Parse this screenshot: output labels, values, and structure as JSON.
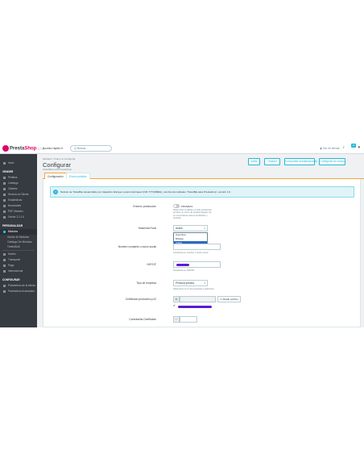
{
  "topbar": {
    "logo_text": "Presta",
    "logo_accent": "Shop",
    "version": "1.7.x",
    "quick_access": "Acceso rápido ▾",
    "search_placeholder": "Q  Buscar",
    "view_shop": "Ver mi tienda",
    "notifications_count": "11",
    "icons": [
      "eye-icon",
      "bell-icon",
      "user-icon"
    ]
  },
  "sidebar": {
    "top_items": [
      "Inicio"
    ],
    "sections": [
      {
        "title": "VENDER",
        "items": [
          "Pedidos",
          "Catálogo",
          "Clientes",
          "Servicio al Cliente",
          "Estadísticas",
          "Novedades",
          "PDF Maestro",
          "Gestor 2.1.1.0"
        ]
      },
      {
        "title": "PERSONALIZAR",
        "items": [
          "Módulos"
        ],
        "subitems": [
          "Gestor de Módulos",
          "Catálogo De Módulos",
          "TreebitSoft"
        ]
      },
      {
        "title": "",
        "items": [
          "Diseño",
          "Transporte",
          "Pago",
          "Internacional"
        ]
      },
      {
        "title": "CONFIGURAR",
        "items": [
          "Parámetros de la tienda",
          "Parámetros Avanzados"
        ]
      }
    ],
    "active_item": "Módulos",
    "colors": {
      "bg": "#363a41",
      "active_accent": "#25b9d7"
    }
  },
  "header": {
    "breadcrumb": "Módulos  /  Ticket  /  ▸ Configurar",
    "title": "Configurar",
    "subtitle": "TicketBAI para PrestaShop",
    "buttons": [
      "Atrás",
      "Traducir",
      "Comprobar actualizaciones",
      "Configurar los hooks"
    ]
  },
  "tabs": [
    {
      "label": "Configuración",
      "active": true
    },
    {
      "label": "Envios pedidos",
      "active": false
    }
  ],
  "alert": {
    "text": "Modulo de TicketBai desarrollado por Alejandro Enrique Lorenzo Enríquez (NIF 77719866A), nombre del software 'TicketBai para Prestashop', versión 1.0"
  },
  "form": {
    "entorno": {
      "label": "Entorno producción",
      "toggle_text": "PRUEBAS",
      "help": "Determinar si utilizar o modo producción se tiene un envío de prueba Ingrese, de un conveniente para el productión y pruebas"
    },
    "hacienda": {
      "label": "Hacienda Foral",
      "value": "Araba",
      "options": [
        "Gipuzkoa",
        "Bizkaia",
        "Araba"
      ],
      "selected": "Araba"
    },
    "nombre": {
      "label": "Nombre completo o razón social",
      "help": "Introduzca su nombre o razón social"
    },
    "nif": {
      "label": "NIF/CIF",
      "help": "Introduzca su NIF/CIF"
    },
    "tipo_empresa": {
      "label": "Tipo de empresa",
      "value": "Persona jurídica",
      "help": "Seleccione si es una empresa o autónomo"
    },
    "certificado": {
      "label": "Certificado productivo p12",
      "upload_button": "Añadir archivo",
      "checkmark": "✔"
    },
    "contrasena": {
      "label": "Contraseña Certificado"
    }
  }
}
